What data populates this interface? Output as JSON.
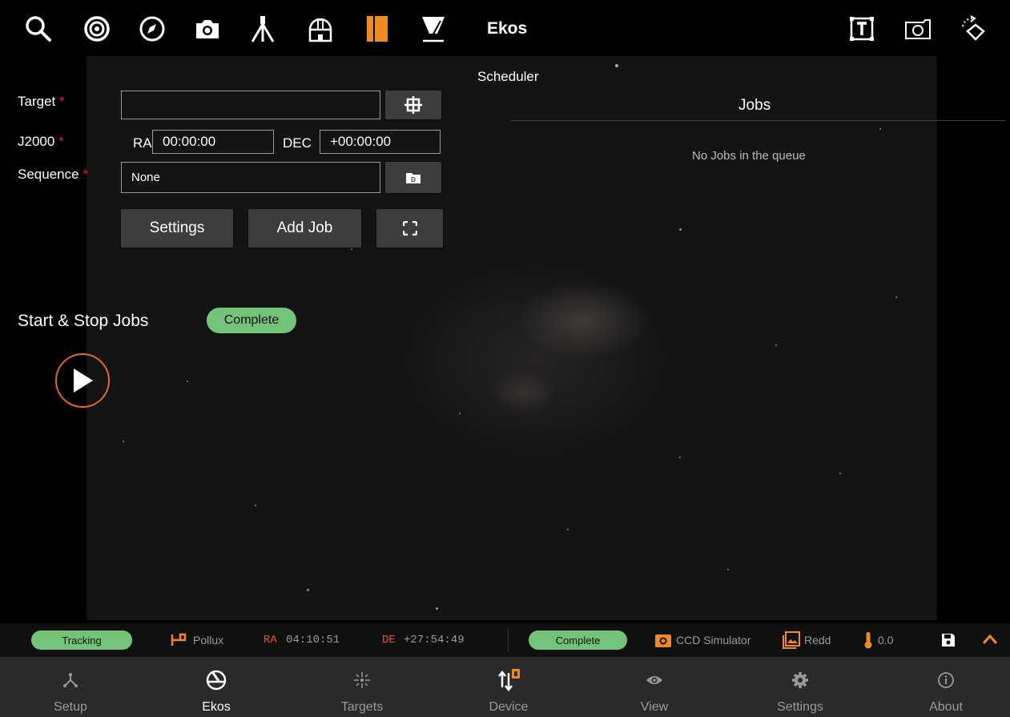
{
  "toolbar": {
    "title": "Ekos",
    "left_icons": [
      "search-icon",
      "target-icon",
      "compass-icon",
      "camera-icon",
      "telescope-icon",
      "observatory-icon",
      "bookmarks-icon",
      "filter-icon"
    ],
    "right_icons": [
      "text-frame-icon",
      "screenshot-icon",
      "rotate-icon"
    ],
    "accent_color": "#f08a24"
  },
  "scheduler": {
    "title": "Scheduler",
    "target_label": "Target",
    "target_value": "",
    "j2000_label": "J2000",
    "ra_label": "RA",
    "ra_value": "00:00:00",
    "dec_label": "DEC",
    "dec_value": "+00:00:00",
    "sequence_label": "Sequence",
    "sequence_value": "None",
    "required_mark": "*",
    "settings_button": "Settings",
    "add_job_button": "Add Job",
    "jobs_title": "Jobs",
    "jobs_empty": "No Jobs in the queue",
    "start_stop_label": "Start & Stop Jobs",
    "status": "Complete"
  },
  "statusbar": {
    "mount_status": "Tracking",
    "target_name": "Pollux",
    "ra_label": "RA",
    "ra_value": "04:10:51",
    "de_label": "DE",
    "de_value": "+27:54:49",
    "capture_status": "Complete",
    "camera_name": "CCD Simulator",
    "filter_name": "Redd",
    "temperature": "0.0",
    "label_color": "#e8552b",
    "pill_color": "#73c379"
  },
  "nav": {
    "items": [
      {
        "label": "Setup",
        "icon": "setup-icon"
      },
      {
        "label": "Ekos",
        "icon": "ekos-icon",
        "active": true
      },
      {
        "label": "Targets",
        "icon": "targets-icon"
      },
      {
        "label": "Device",
        "icon": "device-icon"
      },
      {
        "label": "View",
        "icon": "eye-icon"
      },
      {
        "label": "Settings",
        "icon": "gear-icon"
      },
      {
        "label": "About",
        "icon": "info-icon"
      }
    ]
  }
}
